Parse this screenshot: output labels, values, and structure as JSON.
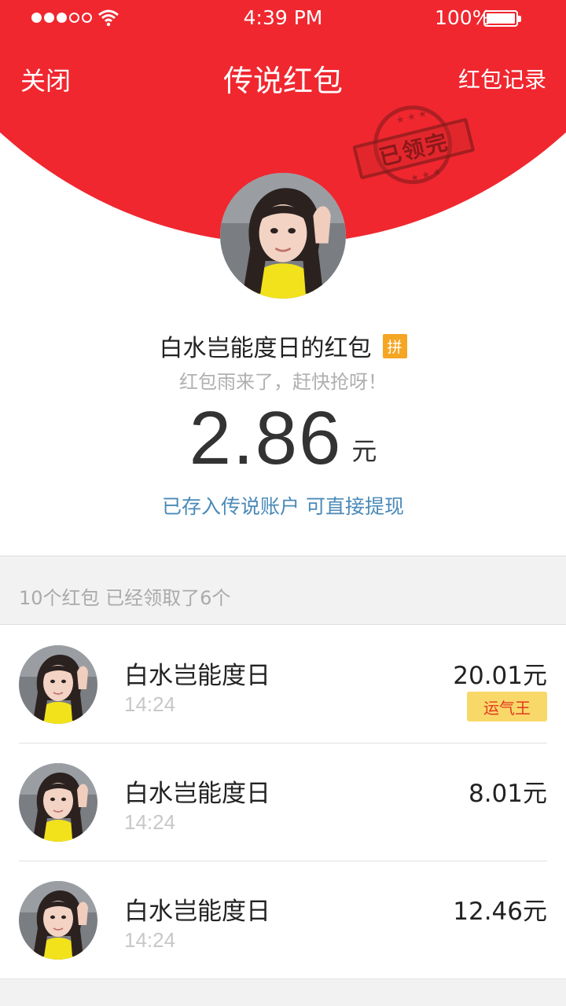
{
  "status_bar": {
    "time": "4:39 PM",
    "battery": "100%"
  },
  "nav": {
    "close_label": "关闭",
    "title": "传说红包",
    "records_label": "红包记录"
  },
  "stamp": {
    "text": "已领完"
  },
  "sender": {
    "name": "白水岂能度日的红包",
    "badge": "拼",
    "greeting": "红包雨来了，赶快抢呀！"
  },
  "amount": {
    "value": "2.86",
    "unit": "元",
    "stored_note": "已存入传说账户 可直接提现"
  },
  "summary": {
    "text": "10个红包 已经领取了6个"
  },
  "recipients": [
    {
      "name": "白水岂能度日",
      "time": "14:24",
      "amount": "20.01元",
      "badge": "运气王"
    },
    {
      "name": "白水岂能度日",
      "time": "14:24",
      "amount": "8.01元"
    },
    {
      "name": "白水岂能度日",
      "time": "14:24",
      "amount": "12.46元"
    }
  ],
  "colors": {
    "brand_red": "#f0272f",
    "link_blue": "#4a8ab8",
    "badge_orange": "#f5a623",
    "luck_yellow": "#f9d86a"
  }
}
